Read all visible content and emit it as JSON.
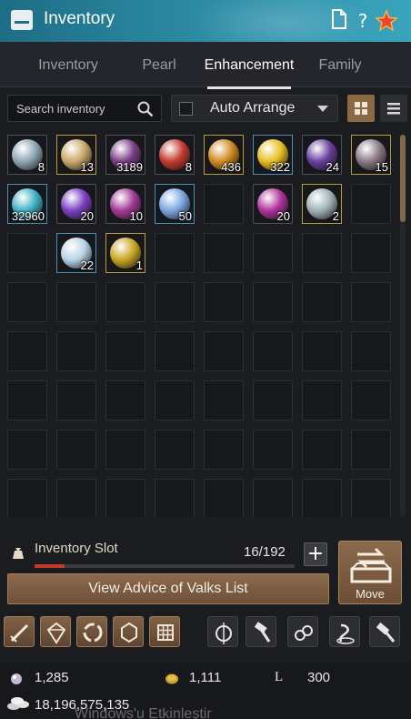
{
  "window": {
    "title": "Inventory"
  },
  "tabs": [
    {
      "label": "Inventory",
      "active": false
    },
    {
      "label": "Pearl",
      "active": false
    },
    {
      "label": "Enhancement",
      "active": true
    },
    {
      "label": "Family",
      "active": false
    }
  ],
  "search": {
    "placeholder": "Search inventory",
    "value": ""
  },
  "auto_arrange": {
    "label": "Auto Arrange",
    "checked": false
  },
  "view_mode": {
    "active": "grid"
  },
  "items": [
    {
      "qty": "8",
      "color": "#8fa7b3",
      "frame": "filled"
    },
    {
      "qty": "13",
      "color": "#c9a86a",
      "frame": "gold"
    },
    {
      "qty": "3189",
      "color": "#7c3e8a",
      "frame": "filled"
    },
    {
      "qty": "8",
      "color": "#c43a2e",
      "frame": "filled"
    },
    {
      "qty": "436",
      "color": "#d08a1e",
      "frame": "gold"
    },
    {
      "qty": "322",
      "color": "#e8c020",
      "frame": "blue"
    },
    {
      "qty": "24",
      "color": "#6a3f9c",
      "frame": "filled"
    },
    {
      "qty": "15",
      "color": "#8a7a86",
      "frame": "gold"
    },
    {
      "qty": "32960",
      "color": "#3fb3c4",
      "frame": "blue"
    },
    {
      "qty": "20",
      "color": "#7b3fc2",
      "frame": "filled"
    },
    {
      "qty": "10",
      "color": "#a23a96",
      "frame": "filled"
    },
    {
      "qty": "50",
      "color": "#7aa6e0",
      "frame": "blue"
    },
    {
      "qty": "",
      "color": "",
      "frame": "empty"
    },
    {
      "qty": "20",
      "color": "#b0329c",
      "frame": "filled"
    },
    {
      "qty": "2",
      "color": "#9fb2b6",
      "frame": "gold"
    },
    {
      "qty": "",
      "color": "",
      "frame": "empty"
    },
    {
      "qty": "",
      "color": "",
      "frame": "empty"
    },
    {
      "qty": "22",
      "color": "#b8d4e6",
      "frame": "blue"
    },
    {
      "qty": "1",
      "color": "#c9a624",
      "frame": "gold"
    }
  ],
  "grid": {
    "columns": 8,
    "rows": 8
  },
  "inventory_slot": {
    "label": "Inventory Slot",
    "count": "16/192",
    "used": 16,
    "total": 192
  },
  "buttons": {
    "advice": "View Advice of Valks List",
    "move": "Move"
  },
  "tools": [
    "sword-enhance-icon",
    "crystal-icon",
    "cycle-icon",
    "gem-icon",
    "grid-icon",
    "compass-icon",
    "hammer-icon",
    "spiral-icon",
    "alchemy-icon",
    "anvil-hammer-icon"
  ],
  "currency": {
    "pearls": "1,285",
    "coins": "1,111",
    "loyalty_symbol": "L",
    "loyalty": "300",
    "silver": "18,196,575,135"
  },
  "watermark": "Windows'u Etkinleştir",
  "colors": {
    "titlebar": "#2f8fa8",
    "accent_brown": "#8a6a45",
    "capacity_fill": "#c0392b"
  }
}
